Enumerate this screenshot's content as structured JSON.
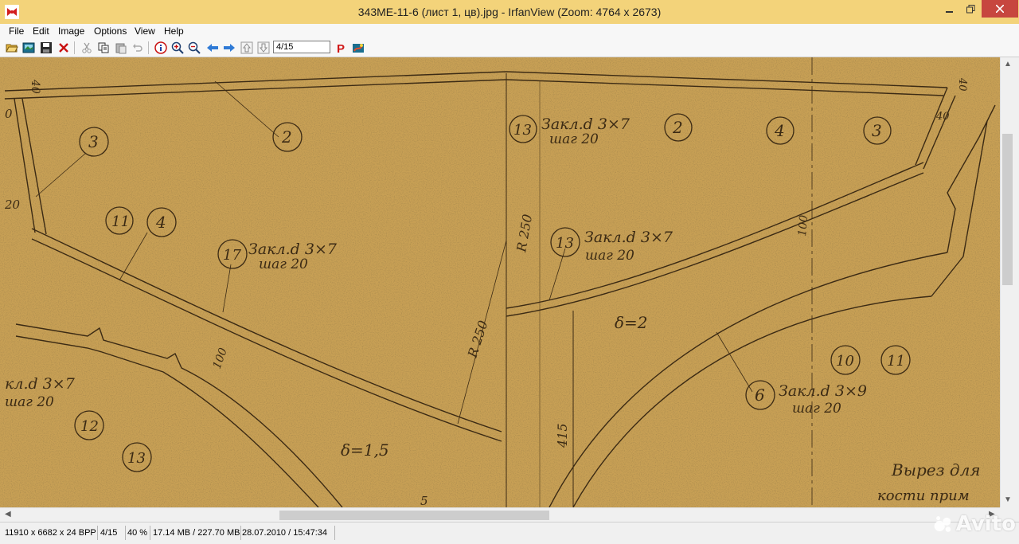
{
  "window": {
    "title": "343ME-11-6 (лист 1, цв).jpg - IrfanView (Zoom: 4764 x 2673)"
  },
  "menu": {
    "items": [
      "File",
      "Edit",
      "Image",
      "Options",
      "View",
      "Help"
    ]
  },
  "toolbar": {
    "page_value": "4/15",
    "icons": [
      "open-icon",
      "thumbnails-icon",
      "save-icon",
      "delete-icon",
      "cut-icon",
      "copy-icon",
      "paste-icon",
      "undo-icon",
      "info-icon",
      "zoom-in-icon",
      "zoom-out-icon",
      "previous-icon",
      "next-icon",
      "first-page-icon",
      "last-page-icon",
      "print-icon",
      "paint-icon"
    ]
  },
  "drawing": {
    "labels": {
      "dim_40_left": "40",
      "dim_0_left": "0",
      "dim_20_left": "20",
      "dim_40_right": "40",
      "dim_4_0_right": "40",
      "circle_3_left": "3",
      "circle_2_left": "2",
      "circle_11_left": "11",
      "circle_4_left": "4",
      "circle_17": "17",
      "note_17_line1": "Закл.d 3×7",
      "note_17_line2": "шаг 20",
      "circle_13_top": "13",
      "note_13_top_line1": "Закл.d 3×7",
      "note_13_top_line2": "шаг 20",
      "circle_2_right": "2",
      "circle_4_right": "4",
      "circle_3_right": "3",
      "r250_vertical": "R 250",
      "circle_13_mid": "13",
      "note_13_mid_line1": "Закл.d 3×7",
      "note_13_mid_line2": "шаг 20",
      "dim_100_right": "100",
      "r250_diag": "R 250",
      "dim_100_left": "100",
      "delta_2": "δ=2",
      "note_left_line1": "кл.d 3×7",
      "note_left_line2": "шаг 20",
      "circle_12": "12",
      "circle_13_bottom": "13",
      "delta_1_5": "δ=1,5",
      "dim_415": "415",
      "circle_10": "10",
      "circle_11_right": "11",
      "circle_6": "6",
      "note_6_line1": "Закл.d 3×9",
      "note_6_line2": "шаг 20",
      "cutout_line1": "Вырез для",
      "cutout_line2": "кости прим",
      "dim_5": "5"
    }
  },
  "status": {
    "dimensions": "11910 x 6682 x 24 BPP",
    "page": "4/15",
    "zoom": "40 %",
    "memory": "17.14 MB / 227.70 MB",
    "datetime": "28.07.2010 / 15:47:34"
  },
  "watermark": {
    "text": "Avito"
  },
  "colors": {
    "titlebar": "#f3d37a",
    "close_button": "#c7463f",
    "paper": "#c59a4f",
    "ink": "#3b2a14"
  }
}
